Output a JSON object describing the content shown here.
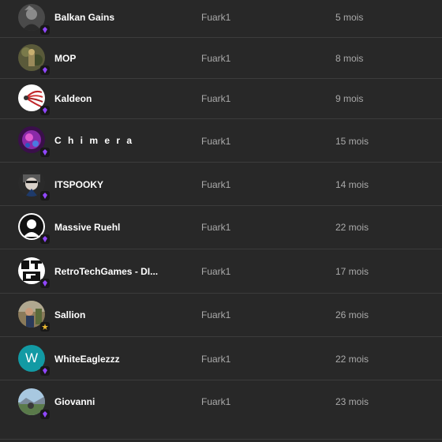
{
  "gift_subs": {
    "rows": [
      {
        "name": "Balkan Gains",
        "gifter": "Fuark1",
        "duration": "5 mois",
        "avatar": "photo-avatar-dark-portrait"
      },
      {
        "name": "MOP",
        "gifter": "Fuark1",
        "duration": "8 mois",
        "avatar": "photo-avatar-camo-figure"
      },
      {
        "name": "Kaldeon",
        "gifter": "Fuark1",
        "duration": "9 mois",
        "avatar": "photo-avatar-red-feathers"
      },
      {
        "name": "C h i m e r a",
        "gifter": "Fuark1",
        "duration": "15 mois",
        "avatar": "photo-avatar-purple-creature"
      },
      {
        "name": "ITSPOOKY",
        "gifter": "Fuark1",
        "duration": "14 mois",
        "avatar": "photo-avatar-masked-face"
      },
      {
        "name": "Massive Ruehl",
        "gifter": "Fuark1",
        "duration": "22 mois",
        "avatar": "photo-avatar-bw-portrait"
      },
      {
        "name": "RetroTechGames - DI...",
        "gifter": "Fuark1",
        "duration": "17 mois",
        "avatar": "logo-avatar-rtg"
      },
      {
        "name": "Sallion",
        "gifter": "Fuark1",
        "duration": "26 mois",
        "avatar": "photo-avatar-outdoor-person"
      },
      {
        "name": "WhiteEaglezzz",
        "gifter": "Fuark1",
        "duration": "22 mois",
        "avatar": "letter-avatar",
        "avatar_letter": "W"
      },
      {
        "name": "Giovanni",
        "gifter": "Fuark1",
        "duration": "23 mois",
        "avatar": "photo-avatar-landscape"
      }
    ],
    "colors": {
      "background": "#282828",
      "row_divider": "#3c3c3c",
      "name_text": "#ffffff",
      "secondary_text": "#aaaaaa",
      "sub_badge": "#9147ff",
      "letter_avatar": "#129aa4"
    }
  }
}
